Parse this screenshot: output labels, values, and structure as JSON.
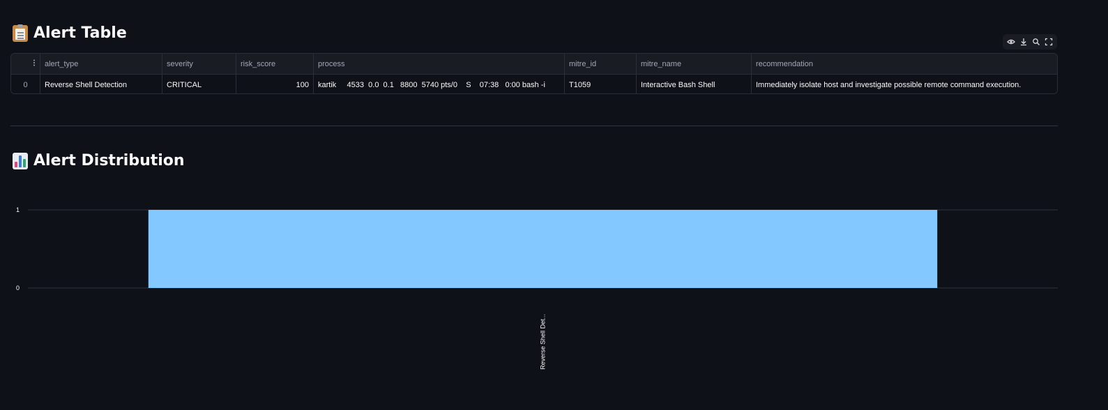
{
  "sections": {
    "alert_table_title": "Alert Table",
    "alert_distribution_title": "Alert Distribution"
  },
  "toolbar": {
    "icons": [
      "eye-icon",
      "download-icon",
      "search-icon",
      "fullscreen-icon"
    ]
  },
  "table": {
    "index_header_icon": "more-vertical-icon",
    "columns": [
      "alert_type",
      "severity",
      "risk_score",
      "process",
      "mitre_id",
      "mitre_name",
      "recommendation"
    ],
    "rows": [
      {
        "index": "0",
        "alert_type": "Reverse Shell Detection",
        "severity": "CRITICAL",
        "risk_score": "100",
        "process": "kartik     4533  0.0  0.1   8800  5740 pts/0    S    07:38   0:00 bash -i",
        "mitre_id": "T1059",
        "mitre_name": "Interactive Bash Shell",
        "recommendation": "Immediately isolate host and investigate possible remote command execution."
      }
    ]
  },
  "chart_data": {
    "type": "bar",
    "categories": [
      "Reverse Shell Det..."
    ],
    "values": [
      1
    ],
    "y_ticks": [
      "0",
      "1"
    ],
    "ylim": [
      0,
      1
    ],
    "bar_color": "#83c9ff",
    "grid": true
  }
}
